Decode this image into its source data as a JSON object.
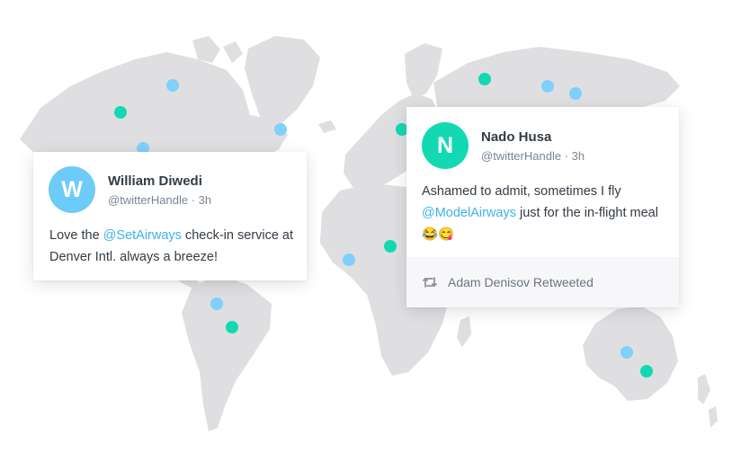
{
  "colors": {
    "land": "#dfdfe2",
    "dot_teal": "#13d9b3",
    "dot_blue": "#7fd0fb",
    "avatar_w": "#6dcbf7",
    "avatar_n": "#13d9b3",
    "mention": "#3fb2e8"
  },
  "map": {
    "markers": [
      {
        "kind": "teal"
      },
      {
        "kind": "blue"
      },
      {
        "kind": "blue"
      },
      {
        "kind": "blue"
      },
      {
        "kind": "teal"
      },
      {
        "kind": "blue"
      },
      {
        "kind": "blue"
      },
      {
        "kind": "teal"
      },
      {
        "kind": "blue"
      },
      {
        "kind": "blue"
      },
      {
        "kind": "teal"
      },
      {
        "kind": "blue"
      },
      {
        "kind": "teal"
      },
      {
        "kind": "blue"
      },
      {
        "kind": "teal"
      }
    ]
  },
  "tweets": [
    {
      "initial": "W",
      "name": "William Diwedi",
      "handle": "@twitterHandle",
      "time": "3h",
      "text_before": "Love the ",
      "mention": "@SetAirways",
      "text_after": " check-in service at Denver Intl. always a breeze!"
    },
    {
      "initial": "N",
      "name": "Nado Husa",
      "handle": "@twitterHandle",
      "time": "3h",
      "text_before": "Ashamed to admit, sometimes I fly ",
      "mention": "@ModelAirways",
      "text_after": "  just for the in-flight meal 😂😋",
      "retweet_label": "Adam Denisov Retweeted",
      "retweet_icon": "retweet-icon"
    }
  ]
}
